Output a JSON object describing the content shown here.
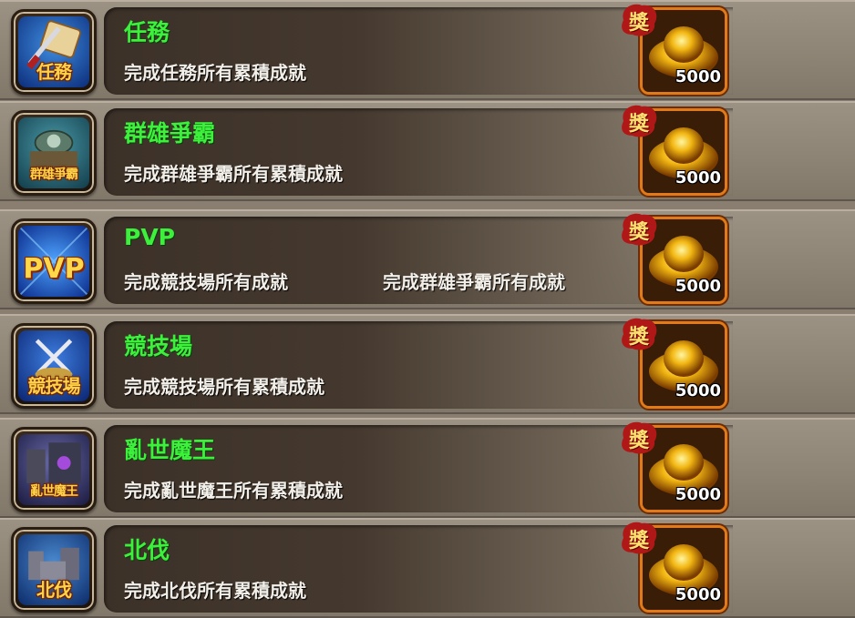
{
  "achievements": [
    {
      "icon_caption": "任務",
      "title": "任務",
      "desc": "完成任務所有累積成就",
      "desc2": "",
      "badge": "獎",
      "reward_amount": "5000",
      "icon": "quest-scroll-icon"
    },
    {
      "icon_caption": "群雄爭霸",
      "title": "群雄爭霸",
      "desc": "完成群雄爭霸所有累積成就",
      "desc2": "",
      "badge": "獎",
      "reward_amount": "5000",
      "icon": "arena-tower-icon"
    },
    {
      "icon_caption": "PVP",
      "title": "PVP",
      "desc": "完成競技場所有成就",
      "desc2": "完成群雄爭霸所有成就",
      "badge": "獎",
      "reward_amount": "5000",
      "icon": "pvp-icon"
    },
    {
      "icon_caption": "競技場",
      "title": "競技場",
      "desc": "完成競技場所有累積成就",
      "desc2": "",
      "badge": "獎",
      "reward_amount": "5000",
      "icon": "crossed-swords-icon"
    },
    {
      "icon_caption": "亂世魔王",
      "title": "亂世魔王",
      "desc": "完成亂世魔王所有累積成就",
      "desc2": "",
      "badge": "獎",
      "reward_amount": "5000",
      "icon": "demon-castle-icon"
    },
    {
      "icon_caption": "北伐",
      "title": "北伐",
      "desc": "完成北伐所有累積成就",
      "desc2": "",
      "badge": "獎",
      "reward_amount": "5000",
      "icon": "fortress-icon"
    }
  ],
  "colors": {
    "title": "#3cf03c",
    "desc": "#f2eee8",
    "reward_border": "#e07a1a",
    "badge": "#b01818"
  }
}
